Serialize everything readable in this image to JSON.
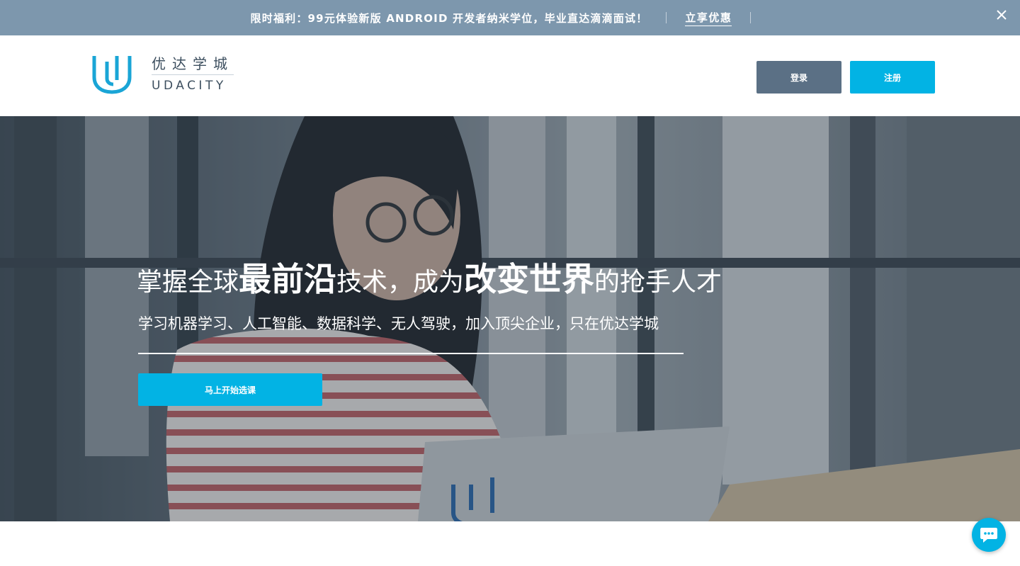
{
  "promo": {
    "text": "限时福利：99元体验新版 ANDROID 开发者纳米学位，毕业直达滴滴面试！",
    "link_label": "立享优惠",
    "close_icon": "close-icon"
  },
  "header": {
    "logo_cn": "优达学城",
    "logo_en": "UDACITY",
    "logo_icon": "udacity-u-logo-icon",
    "login_label": "登录",
    "signup_label": "注册"
  },
  "hero": {
    "title_part1": "掌握全球",
    "title_bold1": "最前沿",
    "title_part2": "技术，成为",
    "title_bold2": "改变世界",
    "title_part3": "的抢手人才",
    "subtitle": "学习机器学习、人工智能、数据科学、无人驾驶，加入顶尖企业，只在优达学城",
    "cta_label": "马上开始选课"
  },
  "chat": {
    "icon": "chat-bubble-icon"
  },
  "colors": {
    "promo_bg": "#7d97ad",
    "brand_blue": "#02b3e4",
    "login_bg": "#5b7085",
    "text_dark": "#3d4f5f"
  }
}
